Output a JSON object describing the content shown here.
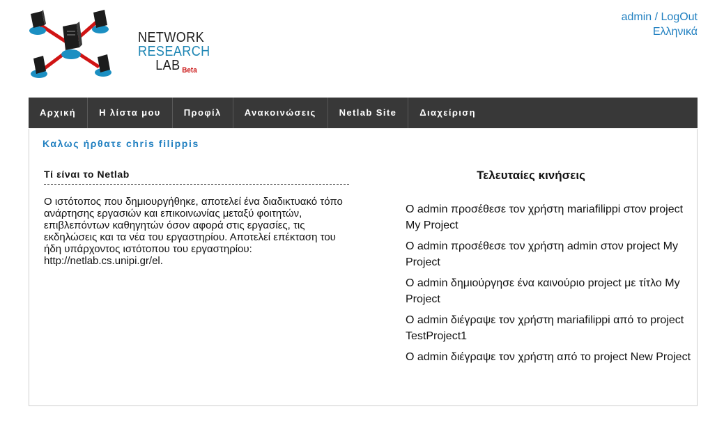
{
  "logo": {
    "line1": "NETWORK",
    "line2": "RESEARCH",
    "line3": "LAB",
    "beta": "Beta"
  },
  "top_links": {
    "user": "admin",
    "separator": "/",
    "logout": "LogOut",
    "language": "Ελληνικά"
  },
  "nav": {
    "items": [
      {
        "label": "Αρχική"
      },
      {
        "label": "Η λίστα μου"
      },
      {
        "label": "Προφίλ"
      },
      {
        "label": "Ανακοινώσεις"
      },
      {
        "label": "Netlab Site"
      },
      {
        "label": "Διαχείριση"
      }
    ]
  },
  "main": {
    "welcome": "Καλως ήρθατε chris filippis",
    "about_title": "Τί είναι το Netlab",
    "about_text": "Ο ιστότοπος που δημιουργήθηκε, αποτελεί ένα διαδικτυακό τόπο ανάρτησης εργασιών και επικοινωνίας μεταξύ φοιτητών, επιβλεπόντων καθηγητών όσον αφορά στις εργασίες, τις εκδηλώσεις και τα νέα του εργαστηρίου. Αποτελεί επέκταση του ήδη υπάρχοντος ιστότοπου του εργαστηρίου: http://netlab.cs.unipi.gr/el.",
    "recent_title": "Τελευταίες κινήσεις",
    "recent": [
      "Ο admin προσέθεσε τον χρήστη mariafilippi στον project My Project",
      "Ο admin προσέθεσε τον χρήστη admin στον project My Project",
      "Ο admin δημιούργησε ένα καινούριο project με τίτλο My Project",
      "Ο admin διέγραψε τον χρήστη mariafilippi από το project TestProject1",
      "Ο admin διέγραψε τον χρήστη από το project New Project"
    ]
  },
  "colors": {
    "nav_bg": "#383838",
    "link": "#1f7fc0",
    "logo_blue": "#1e86b4",
    "logo_red": "#cc1a1a"
  }
}
